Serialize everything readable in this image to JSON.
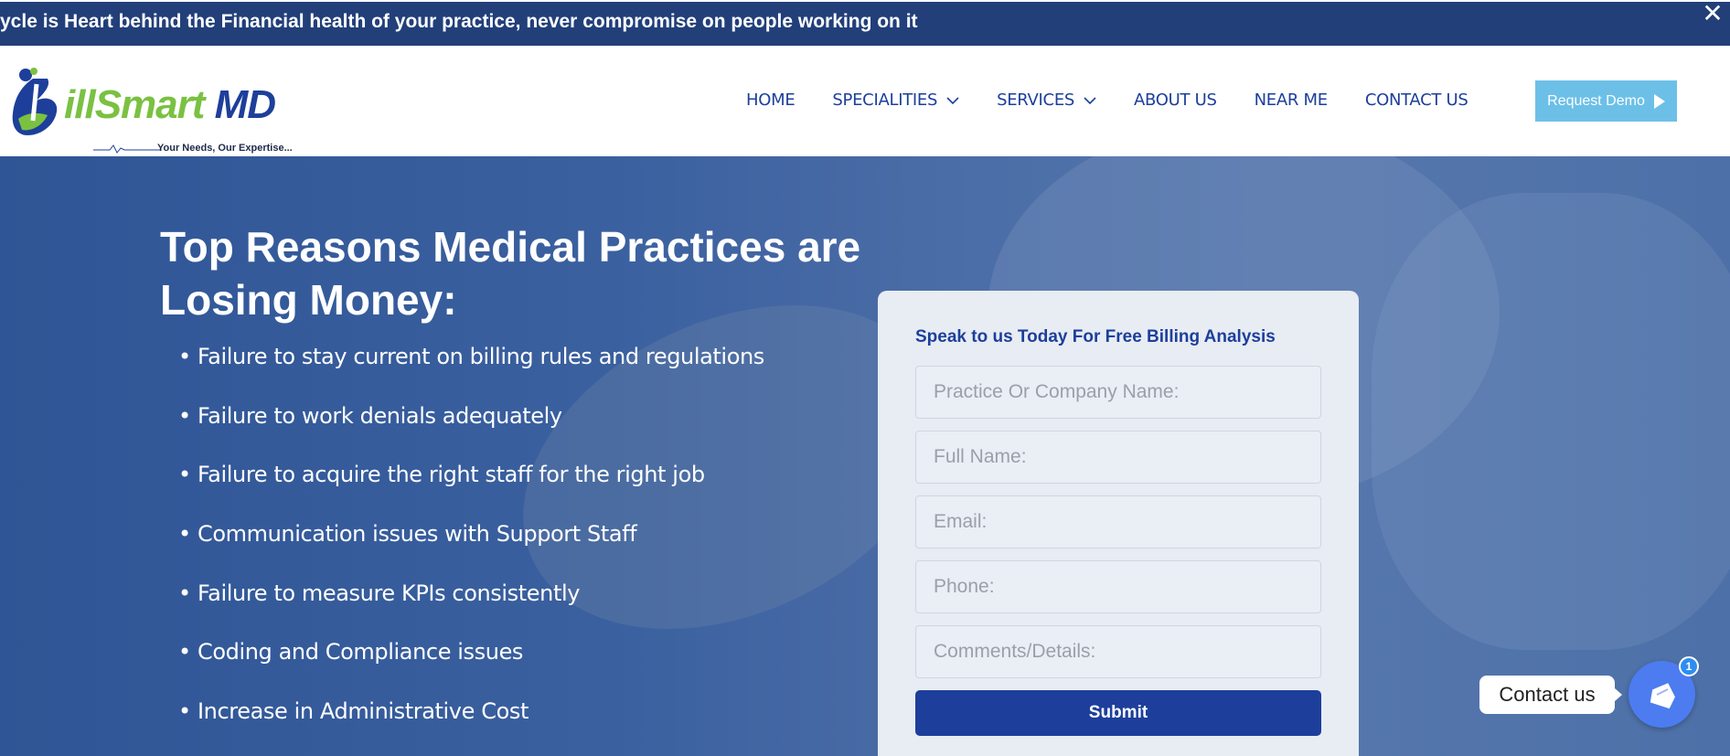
{
  "announcement": {
    "text": "ycle is Heart behind the Financial health of your practice, never compromise on people working on it",
    "close_label": "✕"
  },
  "header": {
    "logo": {
      "brand_part1": "ill",
      "brand_part2": "Smart",
      "brand_part3": "MD",
      "tagline": "Your Needs, Our Expertise..."
    },
    "nav": [
      {
        "label": "HOME",
        "has_dropdown": false
      },
      {
        "label": "SPECIALITIES",
        "has_dropdown": true
      },
      {
        "label": "SERVICES",
        "has_dropdown": true
      },
      {
        "label": "ABOUT US",
        "has_dropdown": false
      },
      {
        "label": "NEAR ME",
        "has_dropdown": false
      },
      {
        "label": "CONTACT US",
        "has_dropdown": false
      }
    ],
    "demo_button": {
      "label": "Request Demo",
      "icon": "play-icon"
    }
  },
  "hero": {
    "title": "Top Reasons Medical Practices are Losing Money:",
    "reasons": [
      "•  Failure to stay current on billing rules and regulations",
      "• Failure to work denials adequately",
      "• Failure to acquire the right staff for the right job",
      "• Communication issues with Support Staff",
      "• Failure to measure KPIs consistently",
      "• Coding and Compliance issues",
      "• Increase in Administrative Cost"
    ]
  },
  "form": {
    "title": "Speak to us Today For Free Billing Analysis",
    "fields": {
      "company": {
        "placeholder": "Practice Or Company Name:",
        "value": ""
      },
      "fullname": {
        "placeholder": "Full Name:",
        "value": ""
      },
      "email": {
        "placeholder": "Email:",
        "value": ""
      },
      "phone": {
        "placeholder": "Phone:",
        "value": ""
      },
      "comments": {
        "placeholder": "Comments/Details:",
        "value": ""
      }
    },
    "submit_label": "Submit"
  },
  "contact_widget": {
    "label": "Contact us",
    "badge_count": "1",
    "icon": "chat-icon"
  },
  "colors": {
    "primary": "#1d3f9b",
    "accent_green": "#7ac142",
    "demo_button": "#6cc0e8",
    "topbar": "#223f7a",
    "widget": "#4d7cf0"
  }
}
